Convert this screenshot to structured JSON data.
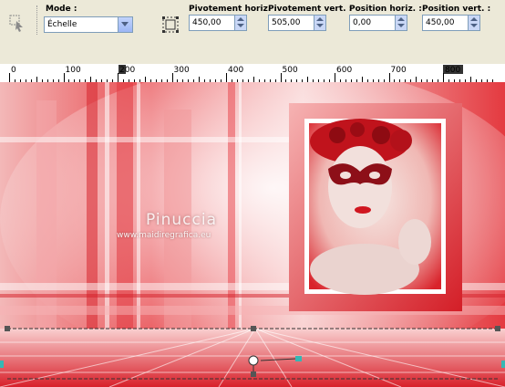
{
  "toolbar": {
    "mode_label": "Mode :",
    "mode_value": "Échelle",
    "pivot_h_label": "Pivotement horiz. :",
    "pivot_h_value": "450,00",
    "pivot_v_label": "Pivotement vert. :",
    "pivot_v_value": "505,00",
    "pos_h_label": "Position horiz. :",
    "pos_h_value": "0,00",
    "pos_v_label": "Position vert. :",
    "pos_v_value": "450,00"
  },
  "ruler": {
    "labels": [
      "0",
      "100",
      "200",
      "300",
      "400",
      "500",
      "600",
      "700",
      "800"
    ]
  },
  "canvas": {
    "watermark_name": "Pinuccia",
    "watermark_url": "www.maidiregrafica.eu"
  },
  "colors": {
    "accent": "#e0262d",
    "toolbar_bg": "#ece9d8"
  }
}
